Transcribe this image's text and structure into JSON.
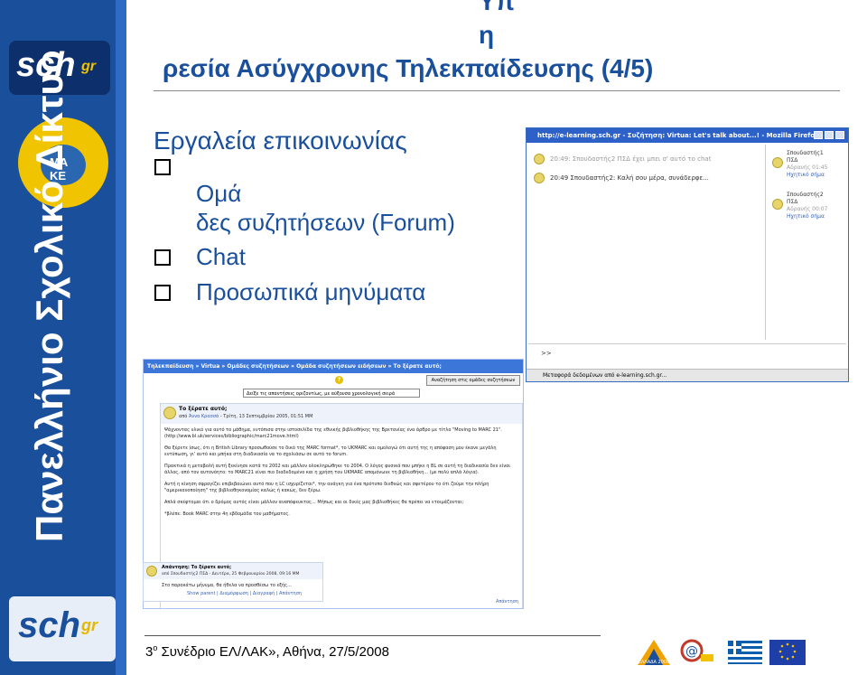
{
  "sidebar": {
    "top_logo": "sch",
    "top_logo_suffix": "gr",
    "emblem_text": "MA KE",
    "vertical_text": "Πανελλήνιο Σχολικό Δίκτυο",
    "bottom_logo": "sch",
    "bottom_logo_suffix": "gr"
  },
  "title": {
    "line1": "Υπ",
    "line2": "η",
    "line3": "ρεσία Ασύγχρονης Τηλεκπαίδευσης (4/5)"
  },
  "content": {
    "heading": "Εργαλεία επικοινωνίας",
    "bullets": [
      {
        "line1": "Ομά",
        "line2": "δες συζητήσεων (Forum)"
      },
      {
        "line1": "Chat"
      },
      {
        "line1": "Προσωπικά μηνύματα"
      }
    ]
  },
  "chat_window": {
    "title": "http://e-learning.sch.gr - Συζήτηση: Virtua: Let's talk about...! - Mozilla Firefox",
    "messages": [
      "20:49: Σπουδαστής2 ΠΣΔ έχει μπει σ' αυτό το chat",
      "20:49 Σπουδαστής2: Καλή σου μέρα, συνάδερφε..."
    ],
    "users": [
      {
        "name": "Σπουδαστής1",
        "sub": "ΠΣΔ",
        "idle": "Αδρανής 01:45",
        "beep": "Ηχητικό σήμα"
      },
      {
        "name": "Σπουδαστής2",
        "sub": "ΠΣΔ",
        "idle": "Αδρανής 00:07",
        "beep": "Ηχητικό σήμα"
      }
    ],
    "input_prompt": ">>",
    "status": "Μεταφορά δεδομένων από e-learning.sch.gr..."
  },
  "forum": {
    "breadcrumb": [
      "Τηλεκπαίδευση",
      "Virtua",
      "Ομάδες συζητήσεων",
      "Ομάδα συζητήσεων ειδήσεων",
      "Το ξέρατε αυτό;"
    ],
    "search_button": "Αναζήτηση στις ομάδες συζητήσεων",
    "display_select": "Δείξε τις απαντήσεις οριζοντίως, με αύξουσα χρονολογική σειρά",
    "post": {
      "title": "Το ξέρατε αυτό;",
      "meta_prefix": "από",
      "author": "Άννα Κρασσά",
      "date": "- Τρίτη, 13 Σεπτεμβρίου 2005, 01:51 ΜΜ",
      "paragraphs": [
        "Ψάχνοντας υλικό για αυτό το μάθημα, εντόπισα στην ιστοσελίδα της εθνικής βιβλιοθήκης της Βρετανίας ένα άρθρο με τίτλο \"Moving to MARC 21\". (http://www.bl.uk/services/bibliographic/marc21move.html)",
        "Θα ξέρετε ίσως, ότι η British Library προσωθούσε το δικό της MARC format*, το UKMARC και ομολογώ ότι αυτή της η απόφαση μου έκανε μεγάλη εντύπωση, γι' αυτό και μπήκα στη διαδικασία να το σχολιάσω σε αυτό το forum.",
        "Πρακτικά η μεταβολή αυτή ξεκίνησε κατά το 2002 και μάλλον ολοκληρώθηκε το 2004. Ο λόγος φυσικά που μπήκε η BL σε αυτή τη διαδικασία δεν είναι άλλος, από τον αυτονόητο: το MARC21 είναι πιο διαδεδομένο και η χρήση του UKMARC απομόνωνε τη βιβλιοθήκη... (με πολύ απλά λόγια).",
        "Αυτή η κίνηση σφραγίζει επιβεβαιώνει αυτό που η LC ισχυρίζεται*, την ανάγκη για ένα πρότυπο διεθνώς και σφετέρου το ότι ζούμε την πλήρη \"αμερικανοποίηση\" της βιβλιοθηκονομίας καλώς ή κακώς, δεν ξέρω.",
        "Απλά σκέφτομαι ότι ο δρόμος αυτός είναι μάλλον αναπόφευκτος... Μήπως και οι δικές μας βιβλιοθήκες θα πρέπει να ετοιμάζονται;",
        "*βλέπε: Book MARC στην 4η εβδομάδα του μαθήματος."
      ],
      "reply": "Απάντηση"
    },
    "reply_post": {
      "title": "Απάντηση: Το ξέρατε αυτό;",
      "meta": "από Σπουδαστής2 ΠΣΔ - Δευτέρα, 25 Φεβρουαρίου 2008, 09:16 ΜΜ",
      "body": "Στο παρακάτω μήνυμα, θα ήθελα να προσθέσω το εξής...",
      "links": "Show parent | Διαμόρφωση | Διαγραφή | Απάντηση"
    }
  },
  "footer": {
    "number": "3",
    "superscript": "ο",
    "text": " Συνέδριο ΕΛ/ΛΑΚ», Αθήνα, 27/5/2008",
    "logos": [
      "ΕΛΛΑΔΑ 2008",
      "@",
      "greek-flag",
      "eu-flag"
    ]
  },
  "colors": {
    "sidebar": "#1a4f9c",
    "title": "#1a4f9c",
    "firefox_titlebar": "#2d61c8",
    "forum_breadcrumb": "#3b76d8",
    "link": "#3a62b8"
  }
}
